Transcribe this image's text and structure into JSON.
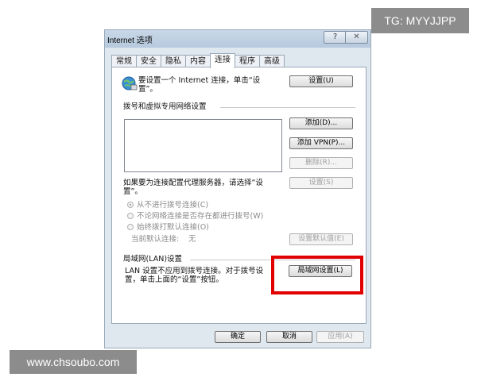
{
  "watermarks": {
    "top": "TG: MYYJJPP",
    "bottom": "www.chsoubo.com"
  },
  "window": {
    "title": "Internet 选项",
    "help": "?",
    "close": "✕"
  },
  "tabs": [
    {
      "label": "常规"
    },
    {
      "label": "安全"
    },
    {
      "label": "隐私"
    },
    {
      "label": "内容"
    },
    {
      "label": "连接",
      "active": true
    },
    {
      "label": "程序"
    },
    {
      "label": "高级"
    }
  ],
  "setup": {
    "line1": "要设置一个 Internet 连接，单击“设",
    "line2": "置”。",
    "button": "设置(U)"
  },
  "dialup": {
    "heading": "拨号和虚拟专用网络设置",
    "add": "添加(D)...",
    "add_vpn": "添加 VPN(P)...",
    "remove": "删除(R)...",
    "proxy_line1": "如果要为连接配置代理服务器，请选择“设",
    "proxy_line2": "置”。",
    "settings": "设置(S)",
    "radio_never": "从不进行拨号连接(C)",
    "radio_whenever": "不论网络连接是否存在都进行拨号(W)",
    "radio_always": "始终拨打默认连接(O)",
    "current_default": "当前默认连接:",
    "current_default_value": "无",
    "set_default": "设置默认值(E)"
  },
  "lan": {
    "heading": "局域网(LAN)设置",
    "line1": "LAN 设置不应用到拨号连接。对于拨号设",
    "line2": "置，单击上面的“设置”按钮。",
    "button": "局域网设置(L)"
  },
  "footer": {
    "ok": "确定",
    "cancel": "取消",
    "apply": "应用(A)"
  },
  "colors": {
    "highlight": "#e00000"
  }
}
